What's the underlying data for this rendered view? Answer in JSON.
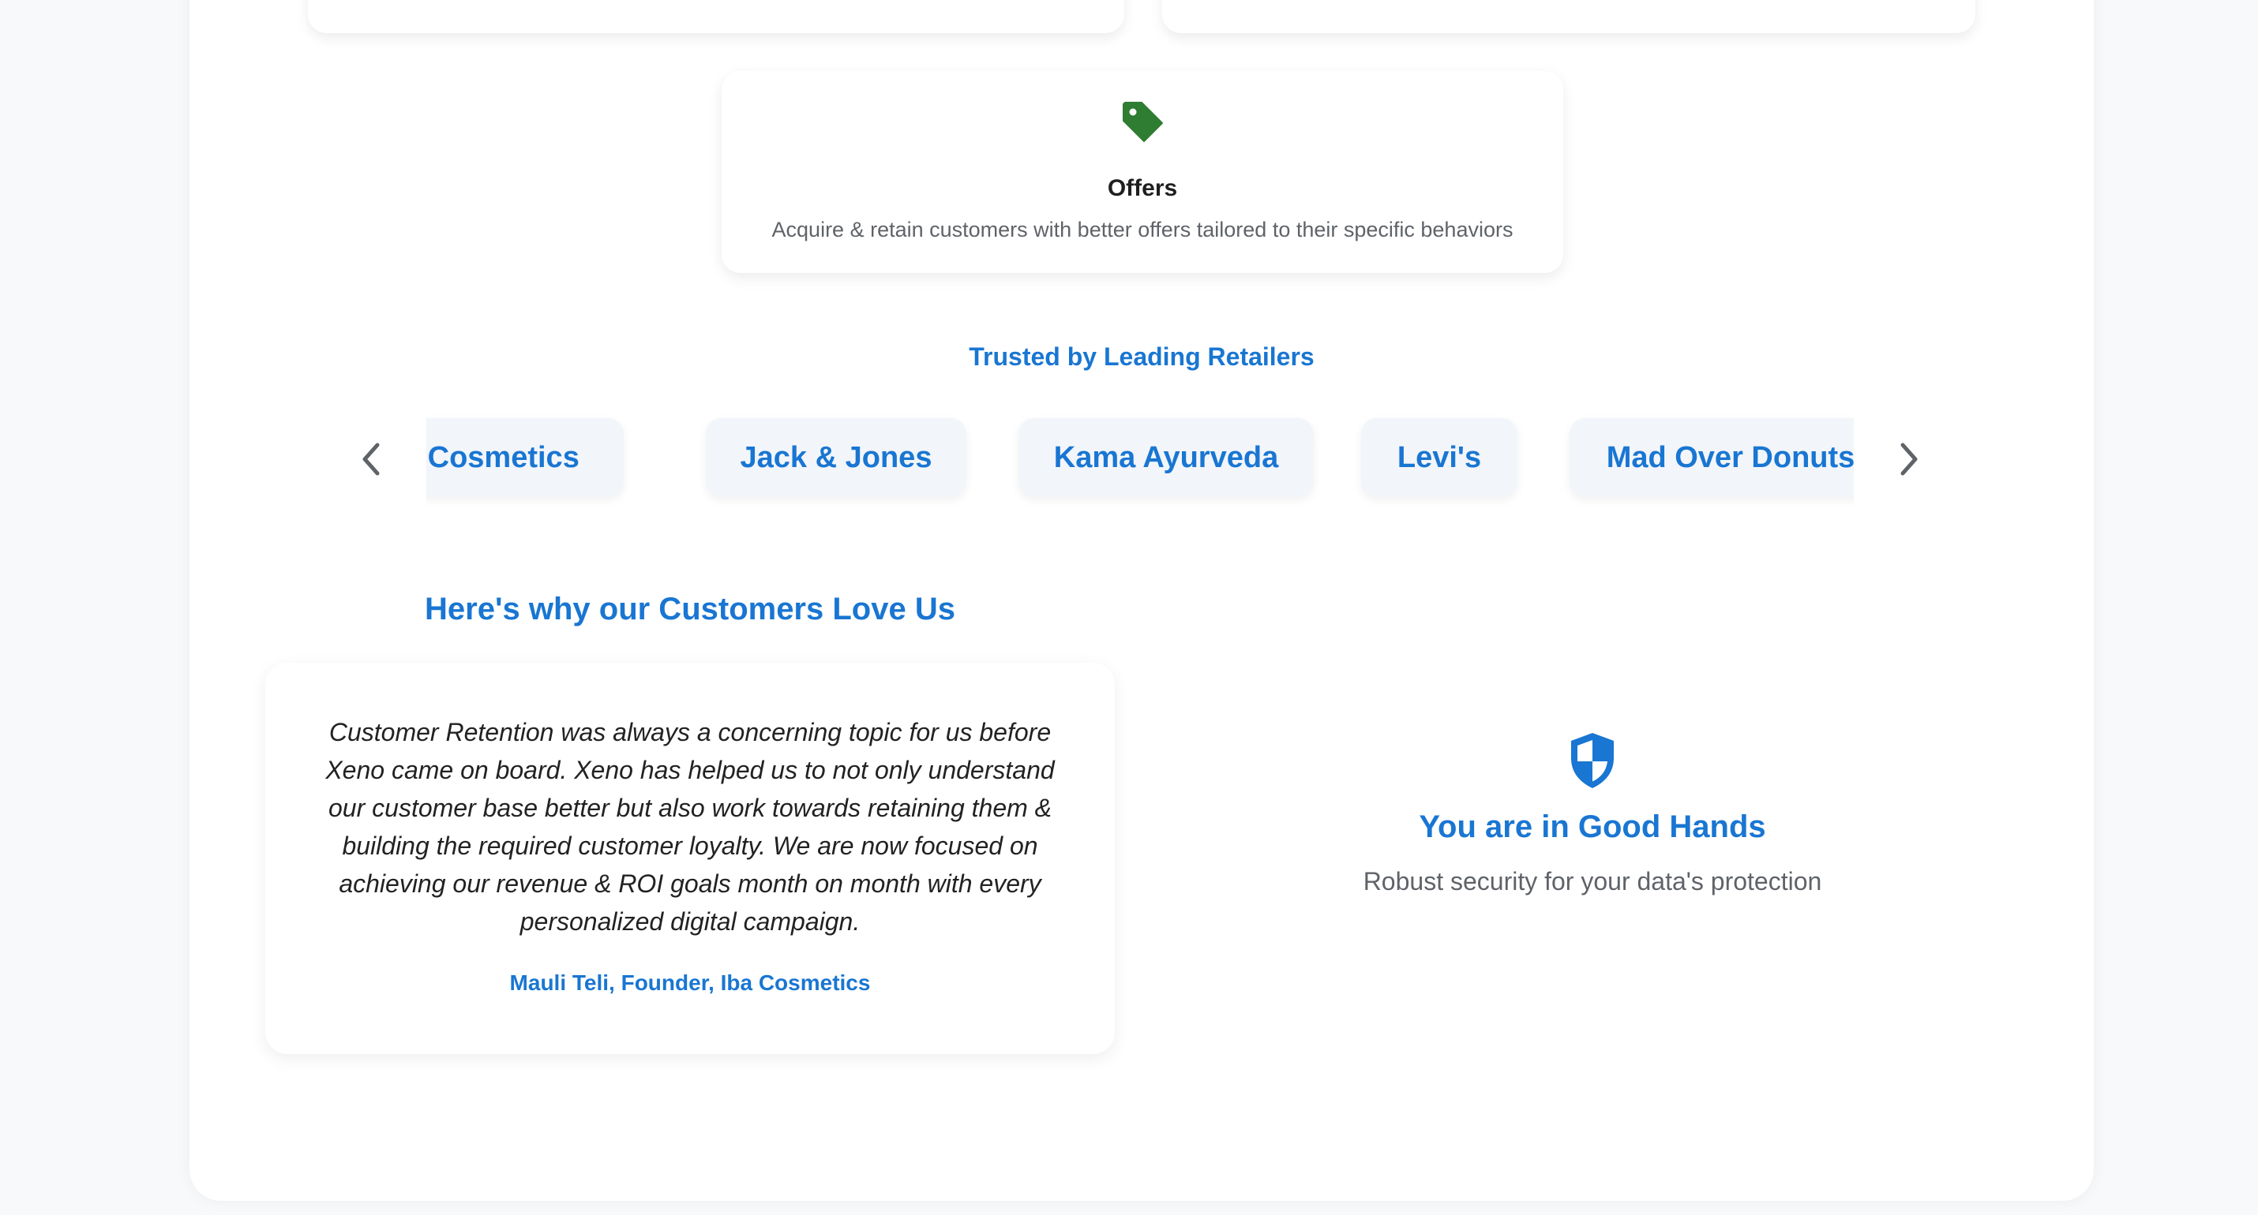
{
  "offers": {
    "title": "Offers",
    "description": "Acquire & retain customers with better offers tailored to their specific behaviors",
    "icon": "tag-icon",
    "icon_color": "#2e7d32"
  },
  "retailers": {
    "title": "Trusted by Leading Retailers",
    "items": [
      "Iba Cosmetics",
      "Jack & Jones",
      "Kama Ayurveda",
      "Levi's",
      "Mad Over Donuts"
    ],
    "prev_icon": "chevron-left-icon",
    "next_icon": "chevron-right-icon"
  },
  "testimonials": {
    "title": "Here's why our Customers Love Us",
    "quote": "Customer Retention was always a concerning topic for us before Xeno came on board. Xeno has helped us to not only understand our customer base better but also work towards retaining them & building the required customer loyalty. We are now focused on achieving our revenue & ROI goals month on month with every personalized digital campaign.",
    "author": "Mauli Teli, Founder, Iba Cosmetics"
  },
  "security": {
    "icon": "shield-icon",
    "title": "You are in Good Hands",
    "description": "Robust security for your data's protection"
  },
  "colors": {
    "accent": "#1976d2",
    "green": "#2e7d32",
    "chip_bg": "#f2f5fa",
    "muted_text": "#5f6368"
  }
}
